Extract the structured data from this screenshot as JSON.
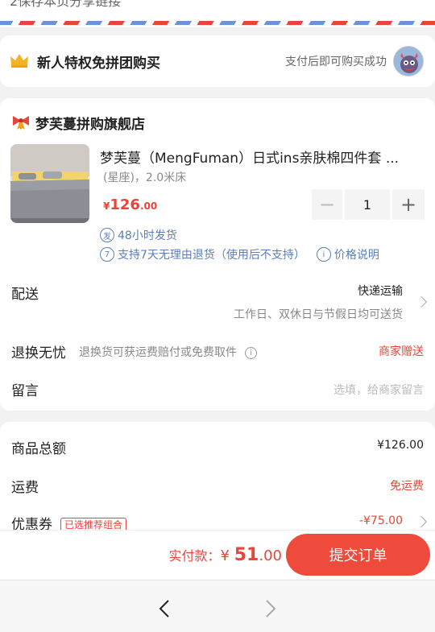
{
  "banner": {
    "top_text": "2保存本页分享链接"
  },
  "perk": {
    "title": "新人特权免拼团购买",
    "note": "支付后即可购买成功"
  },
  "shop": {
    "name": "梦芙蔓拼购旗舰店"
  },
  "product": {
    "title": "梦芙蔓（MengFuman）日式ins亲肤棉四件套 ...",
    "spec": "(星座)，2.0米床",
    "price_symbol": "¥",
    "price_int": "126",
    "price_dec": ".00",
    "quantity": "1",
    "tag_ship": "48小时发货",
    "tag_ship_icon": "发",
    "tag_return_icon": "7",
    "tag_return": "支持7天无理由退货（使用后不支持）",
    "price_note": "价格说明"
  },
  "delivery": {
    "label": "配送",
    "method": "快递运输",
    "detail": "工作日、双休日与节假日均可送货"
  },
  "worry": {
    "label": "退换无忧",
    "desc": "退换货可获运费赔付或免费取件",
    "gift": "商家赠送"
  },
  "note": {
    "label": "留言",
    "placeholder": "选填，给商家留言"
  },
  "summary": {
    "goods_label": "商品总额",
    "goods_value": "¥126.00",
    "freight_label": "运费",
    "freight_value": "免运费",
    "coupon_label": "优惠券",
    "coupon_badge": "已选推荐组合",
    "coupon_value": "-¥75.00"
  },
  "paybar": {
    "label": "实付款：",
    "symbol": "¥ ",
    "amount_int": "51",
    "amount_dec": ".00",
    "submit": "提交订单"
  },
  "colors": {
    "accent": "#e8443a",
    "link": "#5a7fb8"
  }
}
